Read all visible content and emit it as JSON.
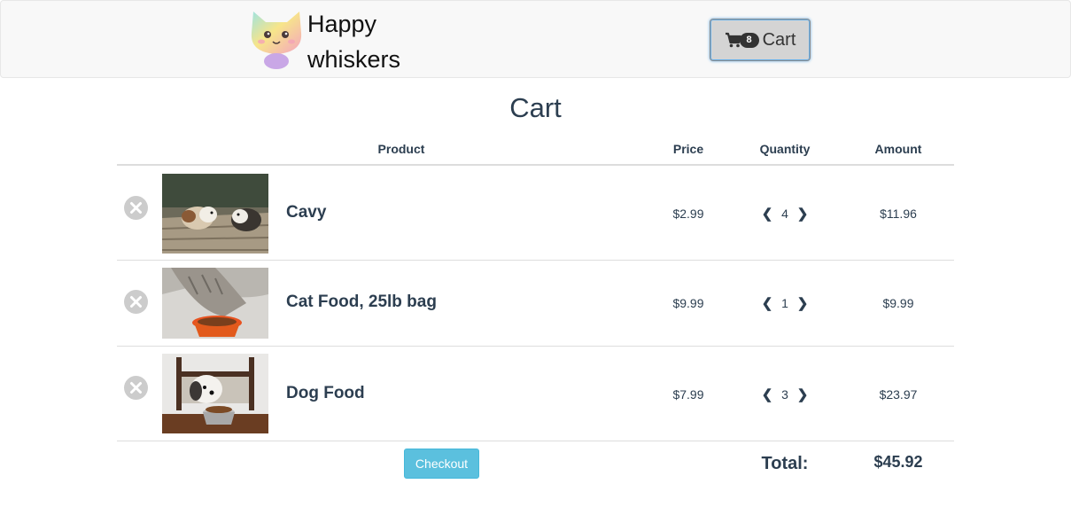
{
  "brand": {
    "line1": "Happy",
    "line2": "whiskers"
  },
  "header": {
    "cart_label": "Cart",
    "cart_count": "8"
  },
  "page": {
    "title": "Cart"
  },
  "table": {
    "columns": {
      "product": "Product",
      "price": "Price",
      "quantity": "Quantity",
      "amount": "Amount"
    },
    "rows": [
      {
        "name": "Cavy",
        "price": "$2.99",
        "quantity": "4",
        "amount": "$11.96"
      },
      {
        "name": "Cat Food, 25lb bag",
        "price": "$9.99",
        "quantity": "1",
        "amount": "$9.99"
      },
      {
        "name": "Dog Food",
        "price": "$7.99",
        "quantity": "3",
        "amount": "$23.97"
      }
    ],
    "qty_decrease": "❮",
    "qty_increase": "❯"
  },
  "footer": {
    "checkout_label": "Checkout",
    "total_label": "Total:",
    "total_value": "$45.92"
  },
  "colors": {
    "accent": "#5bc0de",
    "text": "#2c3e50",
    "remove": "#cccccc"
  }
}
